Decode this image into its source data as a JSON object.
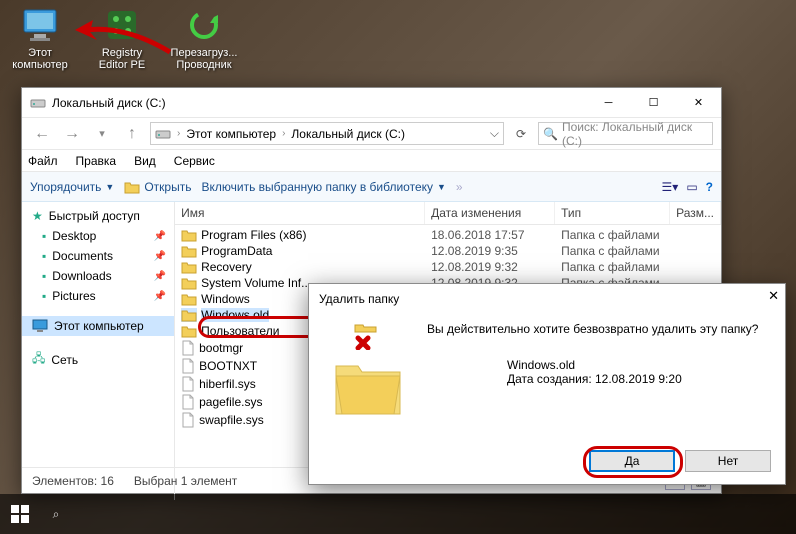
{
  "desktop_icons": [
    {
      "label": "Этот\nкомпьютер",
      "kind": "pc"
    },
    {
      "label": "Registry\nEditor PE",
      "kind": "reg"
    },
    {
      "label": "Перезагруз...\nПроводник",
      "kind": "reload"
    }
  ],
  "window": {
    "title": "Локальный диск (C:)",
    "breadcrumb": [
      "Этот компьютер",
      "Локальный диск (C:)"
    ],
    "search_placeholder": "Поиск: Локальный диск (C:)",
    "menu": [
      "Файл",
      "Правка",
      "Вид",
      "Сервис"
    ],
    "toolbar": {
      "organize": "Упорядочить",
      "open": "Открыть",
      "include": "Включить выбранную папку в библиотеку"
    },
    "columns": {
      "name": "Имя",
      "date": "Дата изменения",
      "type": "Тип",
      "size": "Разм..."
    },
    "sidebar": {
      "quick": "Быстрый доступ",
      "items": [
        "Desktop",
        "Documents",
        "Downloads",
        "Pictures"
      ],
      "this_pc": "Этот компьютер",
      "network": "Сеть"
    },
    "rows": [
      {
        "name": "Program Files (x86)",
        "date": "18.06.2018 17:57",
        "type": "Папка с файлами",
        "icon": "folder"
      },
      {
        "name": "ProgramData",
        "date": "12.08.2019 9:35",
        "type": "Папка с файлами",
        "icon": "folder"
      },
      {
        "name": "Recovery",
        "date": "12.08.2019 9:32",
        "type": "Папка с файлами",
        "icon": "folder"
      },
      {
        "name": "System Volume Inf...",
        "date": "12.08.2019 9:32",
        "type": "Папка с файлами",
        "icon": "folder"
      },
      {
        "name": "Windows",
        "date": "",
        "type": "",
        "icon": "folder"
      },
      {
        "name": "Windows.old",
        "date": "",
        "type": "",
        "icon": "folder",
        "selected": true
      },
      {
        "name": "Пользователи",
        "date": "",
        "type": "",
        "icon": "folder"
      },
      {
        "name": "bootmgr",
        "date": "",
        "type": "",
        "icon": "file"
      },
      {
        "name": "BOOTNXT",
        "date": "",
        "type": "",
        "icon": "file"
      },
      {
        "name": "hiberfil.sys",
        "date": "",
        "type": "",
        "icon": "file"
      },
      {
        "name": "pagefile.sys",
        "date": "",
        "type": "",
        "icon": "file"
      },
      {
        "name": "swapfile.sys",
        "date": "",
        "type": "",
        "icon": "file"
      }
    ],
    "status": {
      "count": "Элементов: 16",
      "selected": "Выбран 1 элемент"
    }
  },
  "dialog": {
    "title": "Удалить папку",
    "message": "Вы действительно хотите безвозвратно удалить эту папку?",
    "item_name": "Windows.old",
    "created_label": "Дата создания: 12.08.2019 9:20",
    "yes": "Да",
    "no": "Нет"
  }
}
